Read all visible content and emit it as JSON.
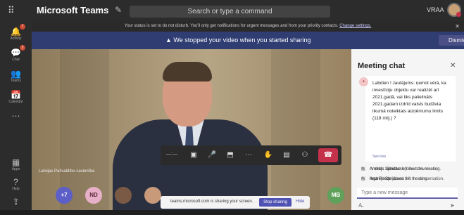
{
  "app": {
    "name": "Microsoft Teams",
    "search_placeholder": "Search or type a command",
    "user_initials": "VRAA"
  },
  "rail": [
    {
      "icon": "bell-icon",
      "label": "Activity",
      "badge": "7"
    },
    {
      "icon": "chat-icon",
      "label": "Chat",
      "badge": "3"
    },
    {
      "icon": "teams-icon",
      "label": "Teams",
      "badge": ""
    },
    {
      "icon": "calendar-icon",
      "label": "Calendar",
      "badge": ""
    },
    {
      "icon": "more-icon",
      "label": "",
      "badge": ""
    },
    {
      "icon": "apps-icon",
      "label": "Apps",
      "badge": ""
    },
    {
      "icon": "help-icon",
      "label": "Help",
      "badge": ""
    },
    {
      "icon": "upload-icon",
      "label": "",
      "badge": ""
    }
  ],
  "notice": {
    "text": "Your status is set to do not disturb. You'll only get notifications for urgent messages and from your priority contacts.",
    "link": "Change settings."
  },
  "banner": {
    "message": "We stopped your video when you started sharing",
    "dismiss": "Dismiss"
  },
  "video": {
    "caption": "Latvijas Pašvaldību savienība"
  },
  "participants": [
    "+7",
    "ND",
    "MB"
  ],
  "share": {
    "text": "teams.microsoft.com is sharing your screen.",
    "stop": "Stop sharing",
    "hide": "Hide"
  },
  "chat": {
    "title": "Meeting chat",
    "message": "Labdien ! Jautājums: ņemot vērā, ka investīciju objektu var realizēt arī 2021.gadā, vai tiks palielināts 2021.gadam izdrīd valsts budžeta likumā noteiktais aizņēmumu limits (118 milj.) ?",
    "see_less": "See less",
    "events": [
      {
        "icon": "leave-icon",
        "name": "Arnolds Jātnieks",
        "text": "left the conversation."
      },
      {
        "icon": "leave-icon",
        "name": "Andrejs Spridzans",
        "text": "left the conversation."
      },
      {
        "icon": "join-icon",
        "name": "Andrejs Spridzans",
        "text": "joined the meeting."
      },
      {
        "icon": "join-icon",
        "name": "Inga Priede",
        "text": "joined the meeting."
      }
    ],
    "input_placeholder": "Type a new message"
  }
}
